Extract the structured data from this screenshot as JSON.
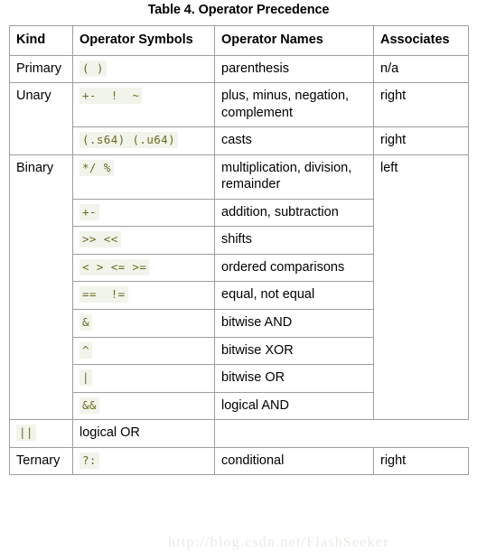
{
  "page": {
    "title": "Table 4. Operator Precedence",
    "watermark": "http://blog.csdn.net/FlashSeeker",
    "code_color": "#6b6b22",
    "code_background": "#f1f4ea",
    "border_color": "#9d9d9d",
    "text_color": "#000000",
    "background": "#ffffff"
  },
  "table": {
    "columns": [
      {
        "key": "kind",
        "label": "Kind"
      },
      {
        "key": "symbols",
        "label": "Operator Symbols"
      },
      {
        "key": "names",
        "label": "Operator Names"
      },
      {
        "key": "associates",
        "label": "Associates"
      }
    ],
    "rows": [
      {
        "kind": "Primary",
        "kind_rowspan": 1,
        "symbols": "( )",
        "names": "parenthesis",
        "associates": "n/a",
        "assoc_rowspan": 1
      },
      {
        "kind": "Unary",
        "kind_rowspan": 2,
        "symbols": "+-  !  ~",
        "names": "plus, minus, negation, complement",
        "associates": "right",
        "assoc_rowspan": 1
      },
      {
        "symbols": "(.s64) (.u64)",
        "names": "casts",
        "associates": "right",
        "assoc_rowspan": 1
      },
      {
        "kind": "Binary",
        "kind_rowspan": 9,
        "symbols": "*/ %",
        "names": "multiplication, division, remainder",
        "associates": "left",
        "assoc_rowspan": 9
      },
      {
        "symbols": "+-",
        "names": "addition, subtraction"
      },
      {
        "symbols": ">> <<",
        "names": "shifts"
      },
      {
        "symbols": "< > <= >=",
        "names": "ordered comparisons"
      },
      {
        "symbols": "==  !=",
        "names": "equal, not equal"
      },
      {
        "symbols": "&",
        "names": "bitwise AND"
      },
      {
        "symbols": "^",
        "names": "bitwise XOR"
      },
      {
        "symbols": "|",
        "names": "bitwise OR"
      },
      {
        "symbols": "&&",
        "names": "logical AND"
      },
      {
        "symbols": "||",
        "names": "logical OR"
      },
      {
        "kind": "Ternary",
        "kind_rowspan": 1,
        "symbols": "?:",
        "names": "conditional",
        "associates": "right",
        "assoc_rowspan": 1
      }
    ]
  }
}
